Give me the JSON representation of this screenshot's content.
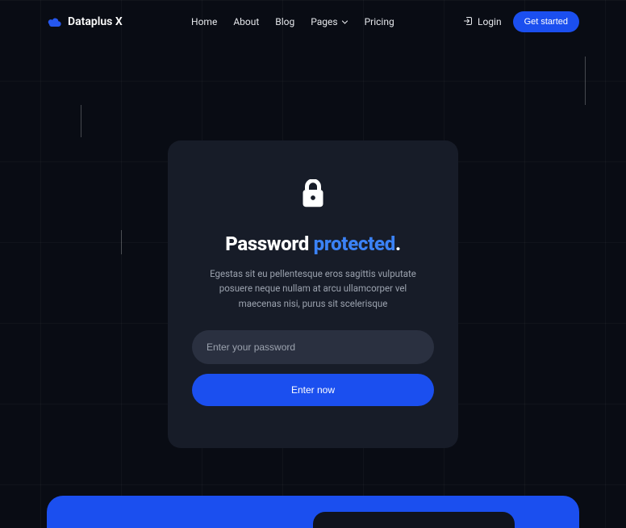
{
  "header": {
    "brand": "Dataplus X",
    "nav": {
      "home": "Home",
      "about": "About",
      "blog": "Blog",
      "pages": "Pages",
      "pricing": "Pricing"
    },
    "login": "Login",
    "get_started": "Get started"
  },
  "card": {
    "title_prefix": "Password ",
    "title_accent": "protected",
    "title_suffix": ".",
    "description": "Egestas sit eu pellentesque eros sagittis vulputate posuere neque nullam at arcu ullamcorper vel maecenas nisi, purus sit scelerisque",
    "placeholder": "Enter your password",
    "submit": "Enter now"
  }
}
